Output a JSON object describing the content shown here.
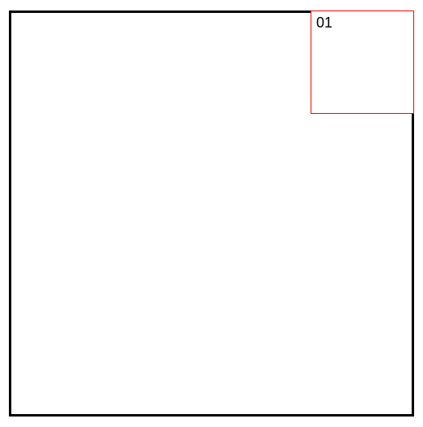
{
  "cell": {
    "label": "01"
  }
}
